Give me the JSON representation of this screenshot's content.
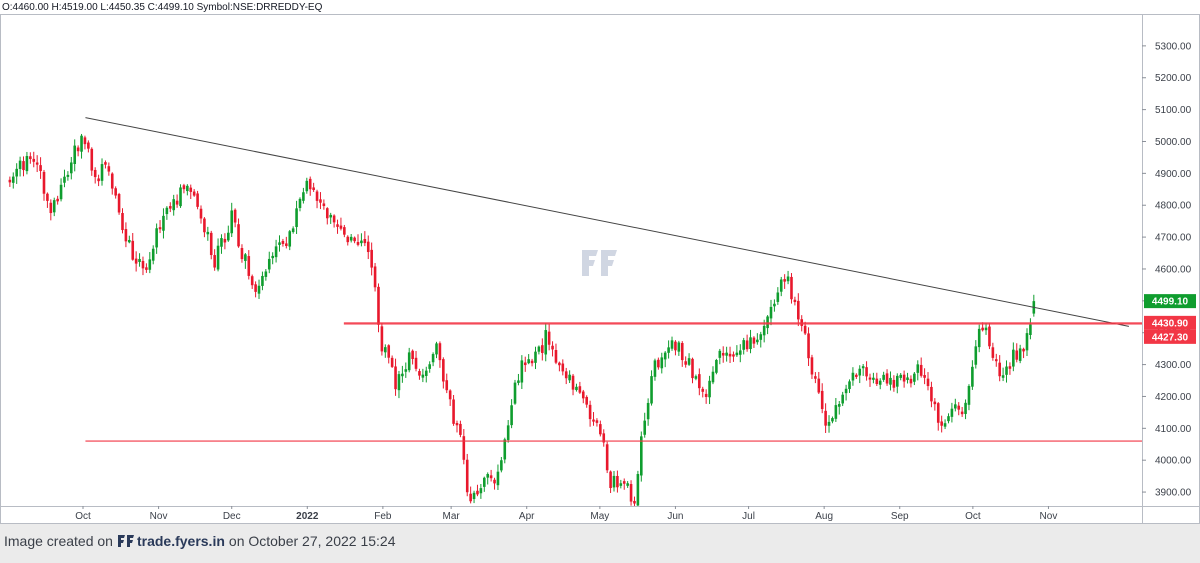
{
  "ohlc": {
    "text": "O:4460.00 H:4519.00 L:4450.35 C:4499.10 Symbol:NSE:DRREDDY-EQ"
  },
  "footer": {
    "prefix": "Image created on",
    "site": "trade.fyers.in",
    "suffix": "on October 27, 2022 15:24"
  },
  "colors": {
    "up": "#0f9d2e",
    "down": "#e8182c",
    "trendline": "#444444",
    "level": "#f23645",
    "last_price_bg": "#0f9d2e",
    "level_label_bg": "#f23645"
  },
  "chart_data": {
    "type": "candlestick",
    "symbol": "NSE:DRREDDY-EQ",
    "ylim": [
      3850,
      5400
    ],
    "y_ticks": [
      3900,
      4000,
      4100,
      4200,
      4300,
      4400,
      4500,
      4600,
      4700,
      4800,
      4900,
      5000,
      5100,
      5200,
      5300
    ],
    "y_tick_labels": [
      "3900.00",
      "4000.00",
      "4100.00",
      "4200.00",
      "4300.00",
      "4400.00",
      "4500.00",
      "4600.00",
      "4700.00",
      "4800.00",
      "4900.00",
      "5000.00",
      "5100.00",
      "5200.00",
      "5300.00"
    ],
    "x_ticks": [
      {
        "label": "Oct",
        "day": 0
      },
      {
        "label": "Nov",
        "day": 31
      },
      {
        "label": "Dec",
        "day": 61
      },
      {
        "label": "2022",
        "day": 92
      },
      {
        "label": "Feb",
        "day": 123
      },
      {
        "label": "Mar",
        "day": 151
      },
      {
        "label": "Apr",
        "day": 182
      },
      {
        "label": "May",
        "day": 212
      },
      {
        "label": "Jun",
        "day": 243
      },
      {
        "label": "Jul",
        "day": 273
      },
      {
        "label": "Aug",
        "day": 304
      },
      {
        "label": "Sep",
        "day": 335
      },
      {
        "label": "Oct",
        "day": 365
      },
      {
        "label": "Nov",
        "day": 396
      }
    ],
    "anchors": [
      [
        -30,
        4880
      ],
      [
        -26,
        4920
      ],
      [
        -20,
        4960
      ],
      [
        -14,
        4790
      ],
      [
        -10,
        4850
      ],
      [
        0,
        5020
      ],
      [
        6,
        4880
      ],
      [
        10,
        4940
      ],
      [
        18,
        4680
      ],
      [
        26,
        4580
      ],
      [
        31,
        4740
      ],
      [
        38,
        4820
      ],
      [
        45,
        4870
      ],
      [
        54,
        4620
      ],
      [
        61,
        4760
      ],
      [
        70,
        4540
      ],
      [
        78,
        4640
      ],
      [
        86,
        4720
      ],
      [
        92,
        4880
      ],
      [
        98,
        4800
      ],
      [
        104,
        4710
      ],
      [
        112,
        4680
      ],
      [
        118,
        4640
      ],
      [
        122,
        4380
      ],
      [
        128,
        4240
      ],
      [
        134,
        4320
      ],
      [
        140,
        4250
      ],
      [
        145,
        4340
      ],
      [
        150,
        4180
      ],
      [
        155,
        4070
      ],
      [
        158,
        3880
      ],
      [
        164,
        3920
      ],
      [
        170,
        3950
      ],
      [
        176,
        4180
      ],
      [
        180,
        4330
      ],
      [
        186,
        4320
      ],
      [
        190,
        4390
      ],
      [
        196,
        4300
      ],
      [
        201,
        4220
      ],
      [
        207,
        4150
      ],
      [
        212,
        4100
      ],
      [
        216,
        3940
      ],
      [
        222,
        3900
      ],
      [
        226,
        3890
      ],
      [
        229,
        4050
      ],
      [
        234,
        4280
      ],
      [
        240,
        4380
      ],
      [
        246,
        4340
      ],
      [
        251,
        4250
      ],
      [
        256,
        4200
      ],
      [
        261,
        4330
      ],
      [
        266,
        4300
      ],
      [
        271,
        4350
      ],
      [
        276,
        4390
      ],
      [
        280,
        4440
      ],
      [
        284,
        4520
      ],
      [
        288,
        4590
      ],
      [
        292,
        4500
      ],
      [
        296,
        4380
      ],
      [
        301,
        4220
      ],
      [
        305,
        4120
      ],
      [
        310,
        4180
      ],
      [
        315,
        4260
      ],
      [
        320,
        4310
      ],
      [
        325,
        4230
      ],
      [
        330,
        4260
      ],
      [
        336,
        4240
      ],
      [
        342,
        4280
      ],
      [
        346,
        4250
      ],
      [
        350,
        4150
      ],
      [
        353,
        4100
      ],
      [
        357,
        4180
      ],
      [
        360,
        4130
      ],
      [
        364,
        4280
      ],
      [
        367,
        4420
      ],
      [
        371,
        4400
      ],
      [
        374,
        4320
      ],
      [
        378,
        4260
      ],
      [
        382,
        4330
      ],
      [
        386,
        4370
      ],
      [
        389,
        4440
      ],
      [
        390,
        4499.1
      ]
    ],
    "trendline": {
      "from": {
        "day": 1,
        "price": 5075
      },
      "to": {
        "day": 429,
        "price": 4420
      }
    },
    "resistance_band": {
      "from_day": 107,
      "upper": 4430.9,
      "lower": 4427.3
    },
    "support_level": {
      "from_day": 1,
      "price": 4060
    },
    "price_labels": [
      {
        "value": 4499.1,
        "text": "4499.10",
        "kind": "last"
      },
      {
        "value": 4430.9,
        "text": "4430.90",
        "kind": "level"
      },
      {
        "value": 4427.3,
        "text": "4427.30",
        "kind": "level"
      }
    ]
  }
}
